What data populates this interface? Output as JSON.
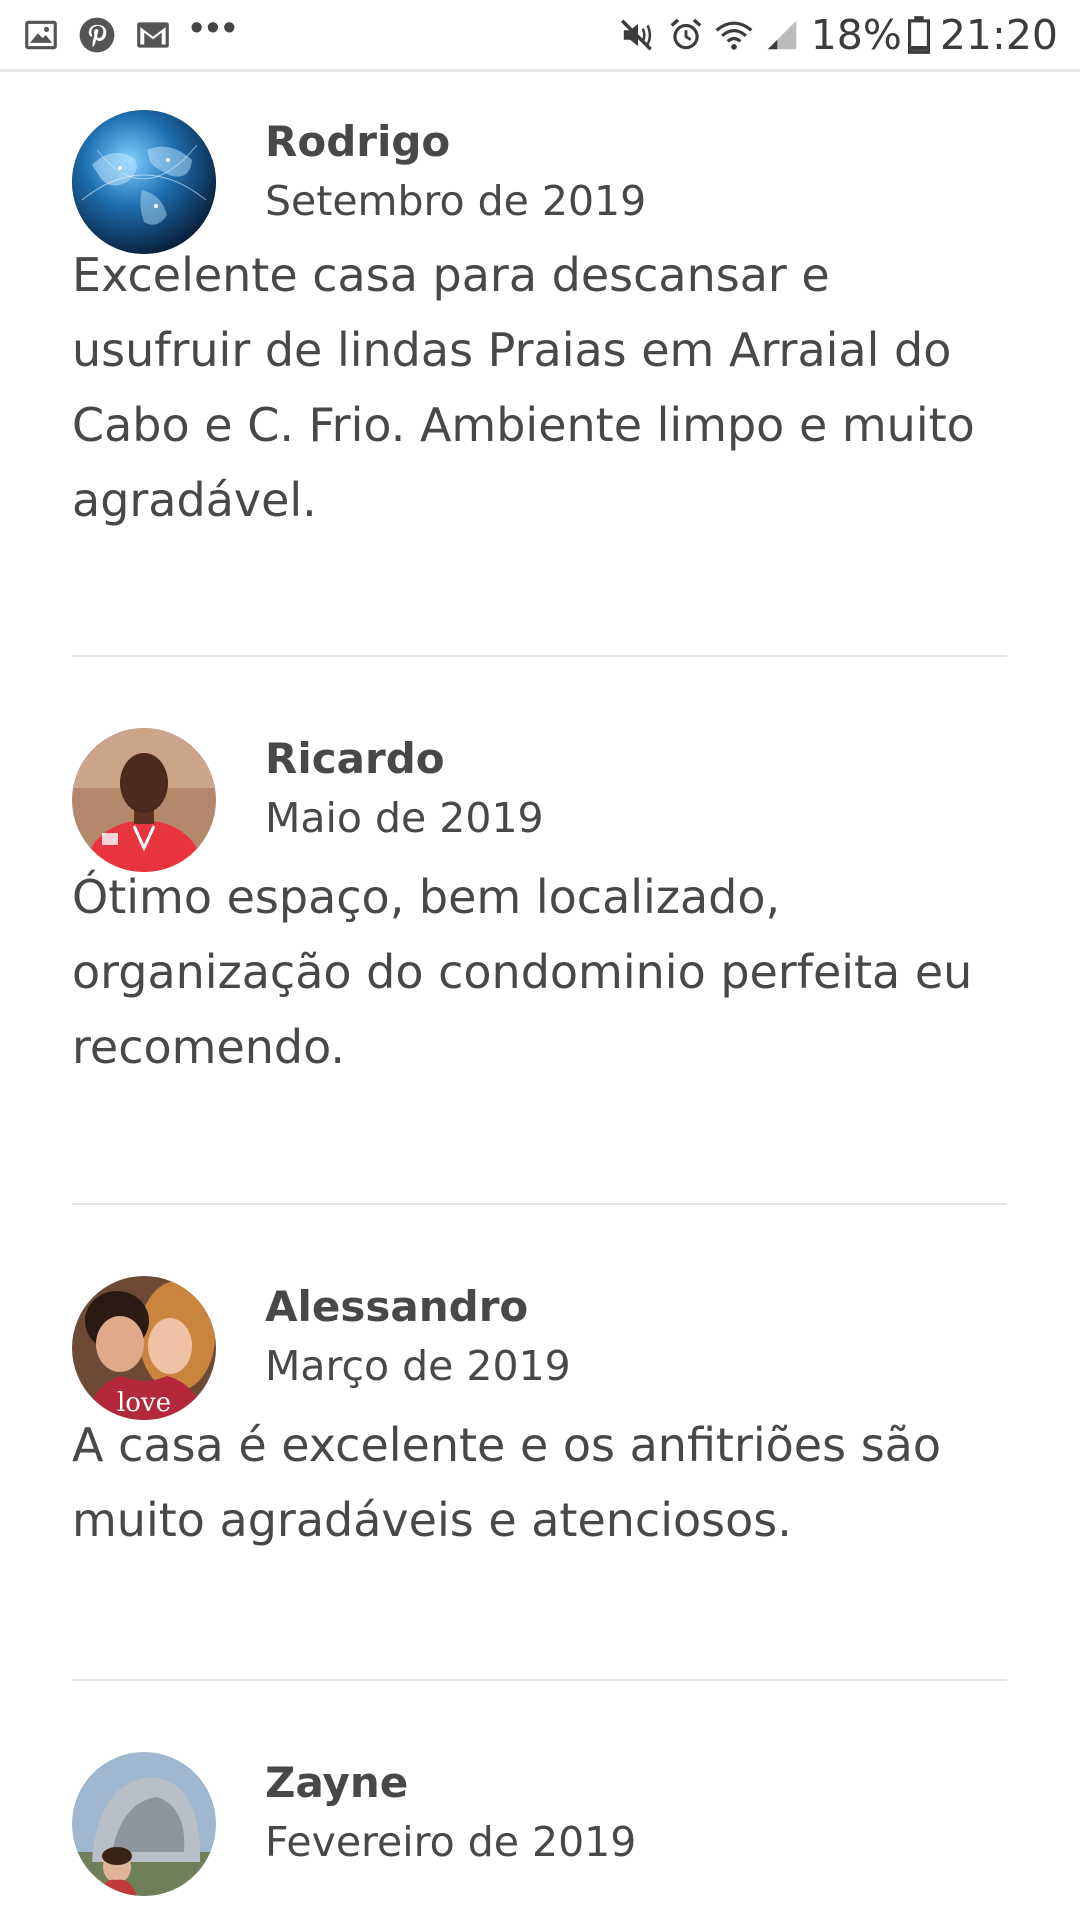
{
  "status_bar": {
    "left_icons": [
      "gallery-icon",
      "pinterest-icon",
      "gmail-icon",
      "more-notifications-icon"
    ],
    "more_label": "•••",
    "right_icons": [
      "mute-icon",
      "alarm-icon",
      "wifi-icon",
      "signal-icon",
      "battery-icon"
    ],
    "battery": "18%",
    "time": "21:20"
  },
  "reviews": [
    {
      "name": "Rodrigo",
      "date": "Setembro de 2019",
      "text": "Excelente casa para descansar e usufruir de lindas Praias em Arraial do Cabo e C. Frio. Ambiente limpo e muito agradável.",
      "avatar": "globe-avatar"
    },
    {
      "name": "Ricardo",
      "date": "Maio de 2019",
      "text": "Ótimo espaço, bem localizado, organização do condominio perfeita eu recomendo.",
      "avatar": "man-red-shirt-avatar"
    },
    {
      "name": "Alessandro",
      "date": "Março de 2019",
      "text": "A casa é excelente e os anfitriões são muito agradáveis e atenciosos.",
      "avatar": "couple-avatar"
    },
    {
      "name": "Zayne",
      "date": "Fevereiro de 2019",
      "text": "",
      "avatar": "sculpture-avatar"
    }
  ],
  "colors": {
    "text": "#484848",
    "divider": "#e4e4e4",
    "background": "#ffffff"
  }
}
